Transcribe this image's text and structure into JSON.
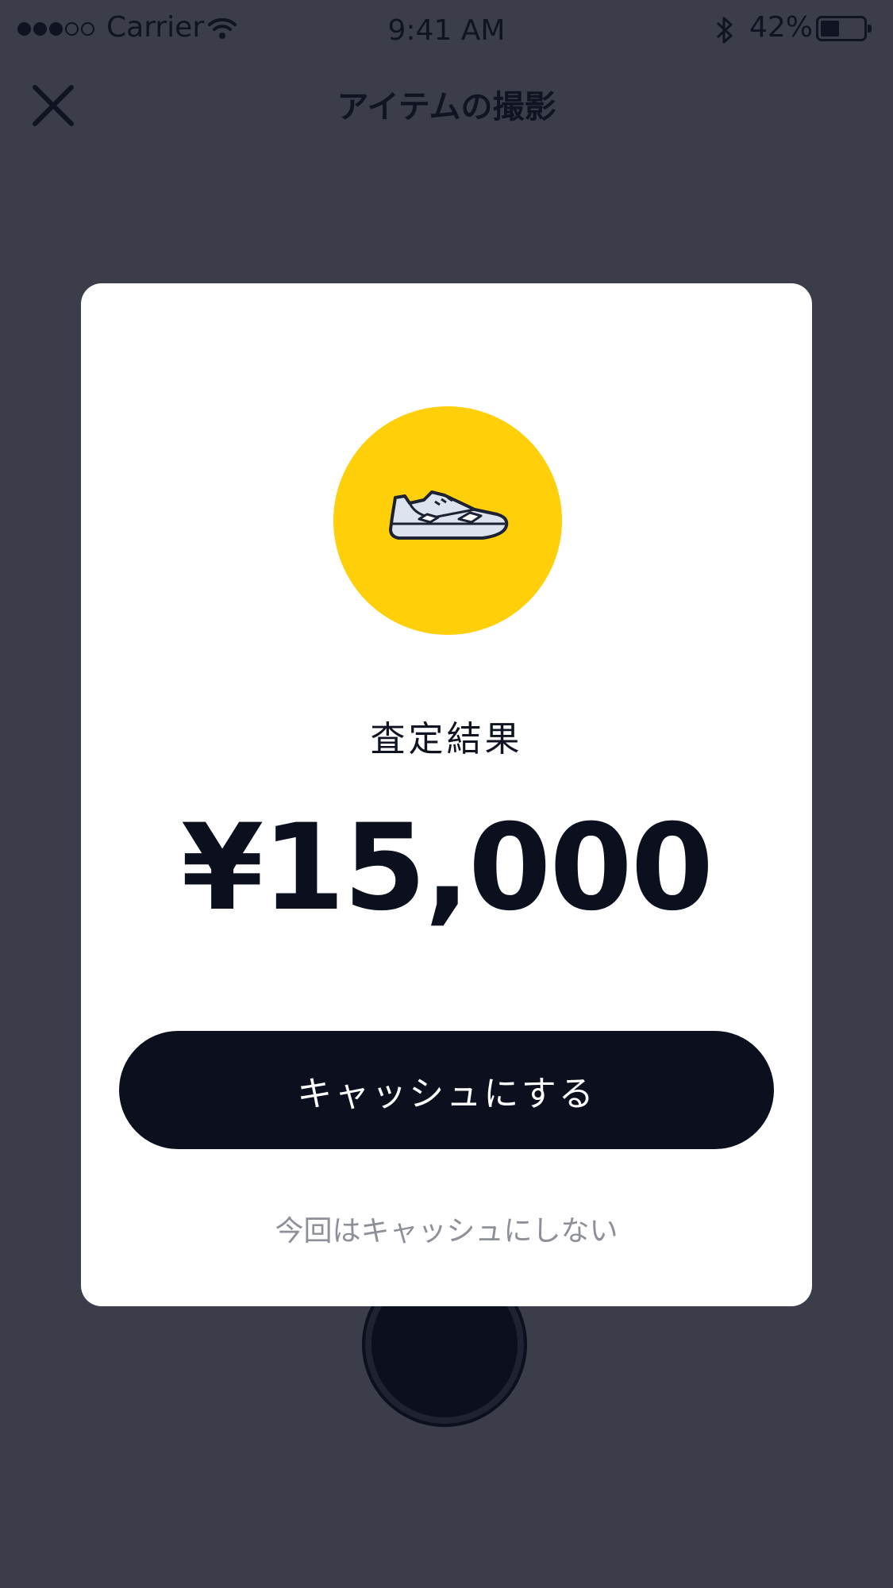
{
  "status_bar": {
    "carrier": "Carrier",
    "time": "9:41 AM",
    "battery_percent": "42%",
    "signal_bars": 3,
    "signal_total": 5,
    "battery_level": 0.42
  },
  "navbar": {
    "title": "アイテムの撮影",
    "close_icon": "close-icon"
  },
  "modal": {
    "badge_color": "#ffcf0a",
    "item_icon": "sneaker-icon",
    "result_label": "査定結果",
    "amount": "¥15,000",
    "cash_button_label": "キャッシュにする",
    "decline_label": "今回はキャッシュにしない"
  },
  "colors": {
    "background": "#3b3d4b",
    "primary_dark": "#0b0f1e",
    "accent_yellow": "#ffcf0a",
    "muted_text": "#8d8f99"
  }
}
